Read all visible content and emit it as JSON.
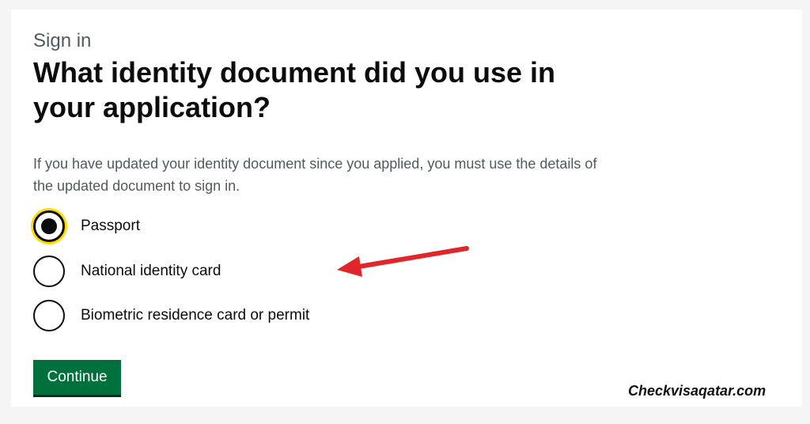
{
  "caption": "Sign in",
  "heading": "What identity document did you use in your application?",
  "hint": "If you have updated your identity document since you applied, you must use the details of the updated document to sign in.",
  "options": [
    {
      "label": "Passport",
      "selected": true
    },
    {
      "label": "National identity card",
      "selected": false
    },
    {
      "label": "Biometric residence card or permit",
      "selected": false
    }
  ],
  "continue_label": "Continue",
  "annotation": {
    "arrow_icon": "red-arrow-icon",
    "color": "#e0262b"
  },
  "watermark": "Checkvisaqatar.com",
  "colors": {
    "primary_button": "#00703c",
    "focus": "#ffdd00",
    "text": "#0b0c0c",
    "hint": "#505a5f"
  }
}
